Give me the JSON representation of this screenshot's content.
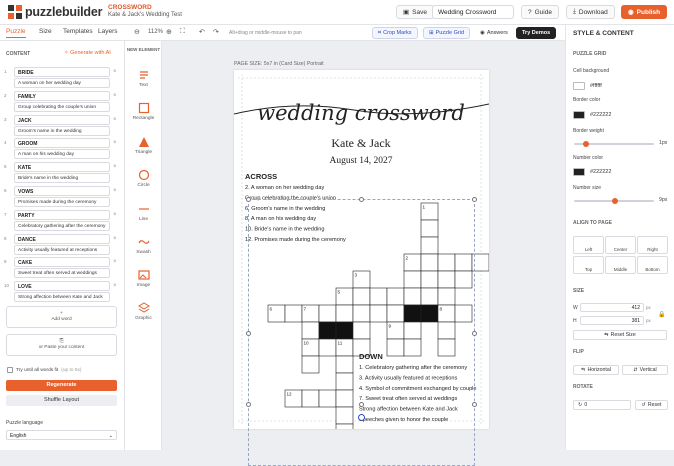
{
  "brand": {
    "logo_text": "puzzlebuilder",
    "accent": "#e8602c"
  },
  "project": {
    "type": "CROSSWORD",
    "title": "Kate & Jack's Wedding Test"
  },
  "header": {
    "save": "Save",
    "title_value": "Wedding Crossword",
    "guide": "Guide",
    "download": "Download",
    "publish": "Publish"
  },
  "tabs": [
    "Puzzle",
    "Size",
    "Templates",
    "Layers"
  ],
  "toolbar": {
    "zoom": "112%",
    "hint": "Alt+drag or middle-mouse to pan",
    "crop_marks": "Crop Marks",
    "puzzle_grid": "Puzzle Grid",
    "answers": "Answers",
    "try_demos": "Try Demos"
  },
  "content": {
    "section": "CONTENT",
    "generate": "Generate with AI",
    "words": [
      {
        "num": "1",
        "word": "BRIDE",
        "clue": "A woman on her wedding day"
      },
      {
        "num": "2",
        "word": "FAMILY",
        "clue": "Group celebrating the couple's union"
      },
      {
        "num": "3",
        "word": "JACK",
        "clue": "Groom's name in the wedding"
      },
      {
        "num": "4",
        "word": "GROOM",
        "clue": "A man on his wedding day"
      },
      {
        "num": "5",
        "word": "KATE",
        "clue": "Bride's name in the wedding"
      },
      {
        "num": "6",
        "word": "VOWS",
        "clue": "Promises made during the ceremony"
      },
      {
        "num": "7",
        "word": "PARTY",
        "clue": "Celebratory gathering after the ceremony"
      },
      {
        "num": "8",
        "word": "DANCE",
        "clue": "Activity usually featured at receptions"
      },
      {
        "num": "9",
        "word": "CAKE",
        "clue": "Sweet treat often served at weddings"
      },
      {
        "num": "10",
        "word": "LOVE",
        "clue": "Strong affection between Kate and Jack"
      }
    ],
    "add_word": "Add word",
    "paste": "or Paste your content",
    "try_until": "Try until all words fit",
    "try_until_note": "(up to 5x)",
    "regenerate": "Regenerate",
    "shuffle": "Shuffle Layout",
    "language_label": "Puzzle language",
    "language_value": "English"
  },
  "elements": {
    "header": "NEW ELEMENT",
    "items": [
      "Text",
      "Rectangle",
      "Triangle",
      "Circle",
      "Line",
      "Swash",
      "Image",
      "Graphic"
    ]
  },
  "page": {
    "size_label": "PAGE SIZE: 5x7 in (Card Size) Portrait",
    "script_title": "wedding crossword",
    "names": "Kate & Jack",
    "date": "August 14, 2027",
    "across_title": "ACROSS",
    "across": [
      "2. A woman on her wedding day",
      "Group celebrating the couple's union",
      "6. Groom's name in the wedding",
      "8. A man on his wedding day",
      "10. Bride's name in the wedding",
      "12. Promises made during the ceremony"
    ],
    "down_title": "DOWN",
    "down": [
      "1. Celebratory gathering after the ceremony",
      "3. Activity usually featured at receptions",
      "4. Symbol of commitment exchanged by couple",
      "7. Sweet treat often served at weddings",
      "Strong affection between Kate and Jack",
      "Speeches given to honor the couple"
    ],
    "grid_numbers": [
      "1",
      "2",
      "3",
      "4",
      "5",
      "6",
      "7",
      "8",
      "9",
      "10",
      "11",
      "12"
    ]
  },
  "style": {
    "heading": "STYLE & CONTENT",
    "puzzle_grid": "PUZZLE GRID",
    "cell_bg_label": "Cell background",
    "cell_bg": "#ffffff",
    "border_color_label": "Border color",
    "border_color": "#222222",
    "border_weight_label": "Border weight",
    "border_weight": "1px",
    "number_color_label": "Number color",
    "number_color": "#222222",
    "number_size_label": "Number size",
    "number_size": "9px",
    "align_title": "ALIGN TO PAGE",
    "align": [
      "Left",
      "Center",
      "Right",
      "Top",
      "Middle",
      "Bottom"
    ],
    "size_title": "SIZE",
    "width_label": "W",
    "width": "412",
    "height_label": "H",
    "height": "381",
    "unit": "px",
    "reset_size": "Reset Size",
    "flip_title": "FLIP",
    "horizontal": "Horizontal",
    "vertical": "Vertical",
    "rotate_title": "ROTATE",
    "rotate": "0",
    "reset": "Reset"
  }
}
